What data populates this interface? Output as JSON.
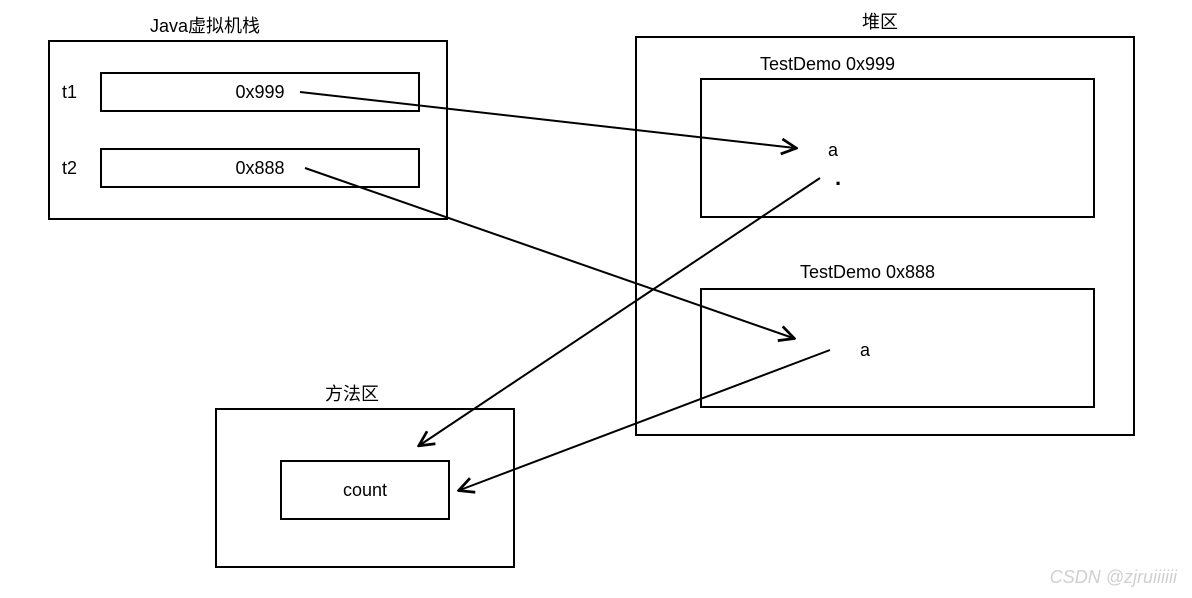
{
  "stack": {
    "title": "Java虚拟机栈",
    "entries": [
      {
        "name": "t1",
        "value": "0x999"
      },
      {
        "name": "t2",
        "value": "0x888"
      }
    ]
  },
  "heap": {
    "title": "堆区",
    "objects": [
      {
        "header": "TestDemo   0x999",
        "field": "a"
      },
      {
        "header": "TestDemo 0x888",
        "field": "a"
      }
    ]
  },
  "method_area": {
    "title": "方法区",
    "field": "count"
  },
  "watermark": "CSDN @zjruiiiiii"
}
